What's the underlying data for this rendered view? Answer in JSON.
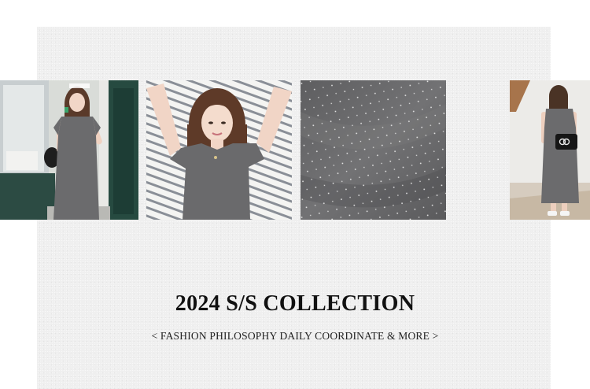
{
  "collection": {
    "title": "2024 S/S COLLECTION",
    "subtitle": "< FASHION PHILOSOPHY DAILY COORDINATE & MORE >"
  },
  "photos": [
    {
      "depicts": "woman-in-grey-dress-at-shop-entrance-icon"
    },
    {
      "depicts": "woman-in-grey-tee-lying-on-striped-sheet-icon"
    },
    {
      "depicts": "grey-fabric-closeup-with-sparkle-dots-icon"
    },
    {
      "depicts": "woman-in-grey-dress-back-view-with-handbag-icon"
    }
  ],
  "colors": {
    "panel_background": "#efefef",
    "dress_grey": "#6b6b6d",
    "title_text": "#111111"
  }
}
